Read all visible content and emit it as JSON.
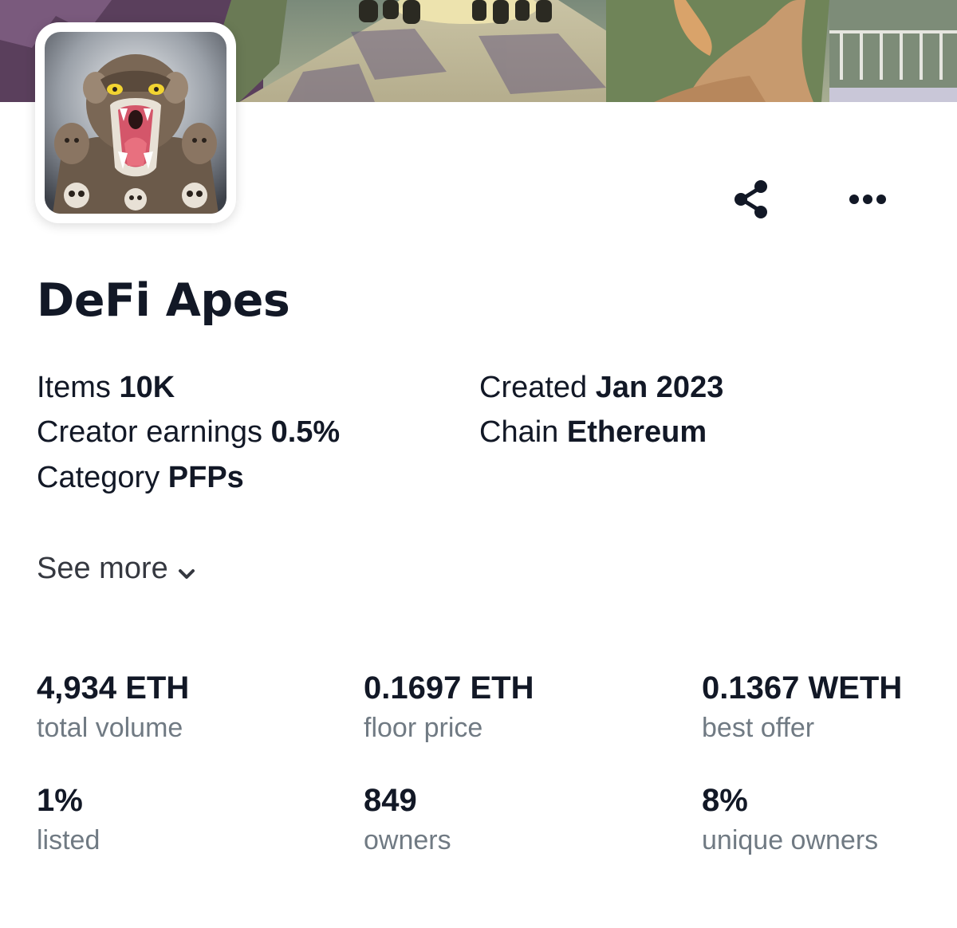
{
  "collection": {
    "name": "DeFi Apes"
  },
  "actions": {
    "share_icon": "share-icon",
    "more_icon": "more-horizontal-icon"
  },
  "details": {
    "items": {
      "label": "Items",
      "value": "10K"
    },
    "creator_earnings": {
      "label": "Creator earnings",
      "value": "0.5%"
    },
    "category": {
      "label": "Category",
      "value": "PFPs"
    },
    "created": {
      "label": "Created",
      "value": "Jan 2023"
    },
    "chain": {
      "label": "Chain",
      "value": "Ethereum"
    }
  },
  "see_more": {
    "label": "See more",
    "icon": "chevron-down-icon"
  },
  "stats": [
    {
      "value": "4,934 ETH",
      "label": "total volume"
    },
    {
      "value": "0.1697 ETH",
      "label": "floor price"
    },
    {
      "value": "0.1367 WETH",
      "label": "best offer"
    },
    {
      "value": "1%",
      "label": "listed"
    },
    {
      "value": "849",
      "label": "owners"
    },
    {
      "value": "8%",
      "label": "unique owners"
    }
  ],
  "colors": {
    "text_primary": "#121826",
    "text_secondary": "#707a83",
    "background": "#ffffff"
  }
}
